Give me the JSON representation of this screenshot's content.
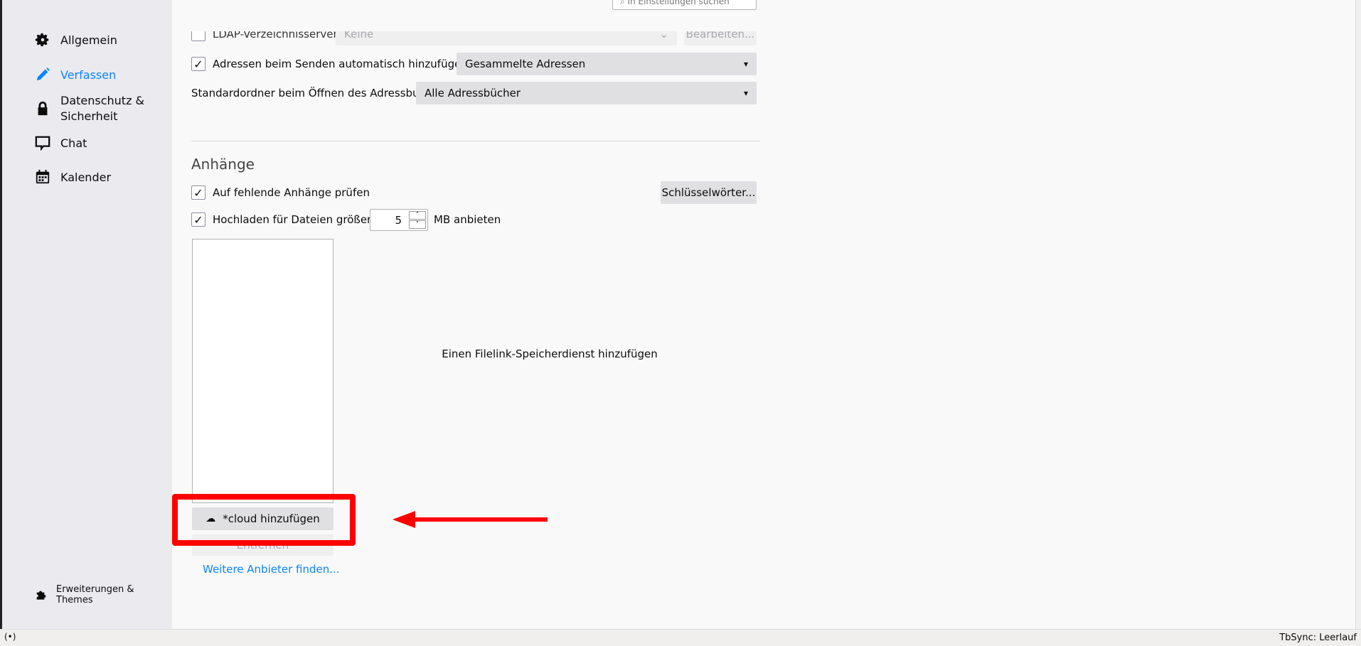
{
  "search": {
    "placeholder": "In Einstellungen suchen"
  },
  "sidebar": {
    "items": [
      {
        "label": "Allgemein",
        "icon": "gear-icon"
      },
      {
        "label": "Verfassen",
        "icon": "pencil-icon",
        "active": true
      },
      {
        "label": "Datenschutz & Sicherheit",
        "icon": "lock-icon"
      },
      {
        "label": "Chat",
        "icon": "chat-icon"
      },
      {
        "label": "Kalender",
        "icon": "calendar-icon"
      }
    ],
    "footer": "Erweiterungen & Themes"
  },
  "addressing": {
    "ldap_label": "LDAP-Verzeichnisserver:",
    "ldap_checked": false,
    "ldap_value": "Keine",
    "ldap_edit": "Bearbeiten...",
    "auto_add_label": "Adressen beim Senden automatisch hinzufügen zu:",
    "auto_add_checked": true,
    "auto_add_value": "Gesammelte Adressen",
    "default_dir_label": "Standardordner beim Öffnen des Adressbuchs:",
    "default_dir_value": "Alle Adressbücher"
  },
  "attachments": {
    "heading": "Anhänge",
    "check_missing_label": "Auf fehlende Anhänge prüfen",
    "check_missing_checked": true,
    "keywords_button": "Schlüsselwörter...",
    "upload_label": "Hochladen für Dateien größer als",
    "upload_checked": true,
    "upload_size": "5",
    "upload_unit": "MB anbieten",
    "empty_text": "Einen Filelink-Speicherdienst hinzufügen",
    "add_button": "*cloud hinzufügen",
    "remove_button": "Entfernen",
    "more_link": "Weitere Anbieter finden..."
  },
  "statusbar": {
    "text": "TbSync: Leerlauf"
  },
  "colors": {
    "accent": "#0a84ff",
    "annotation": "#ff0000"
  }
}
